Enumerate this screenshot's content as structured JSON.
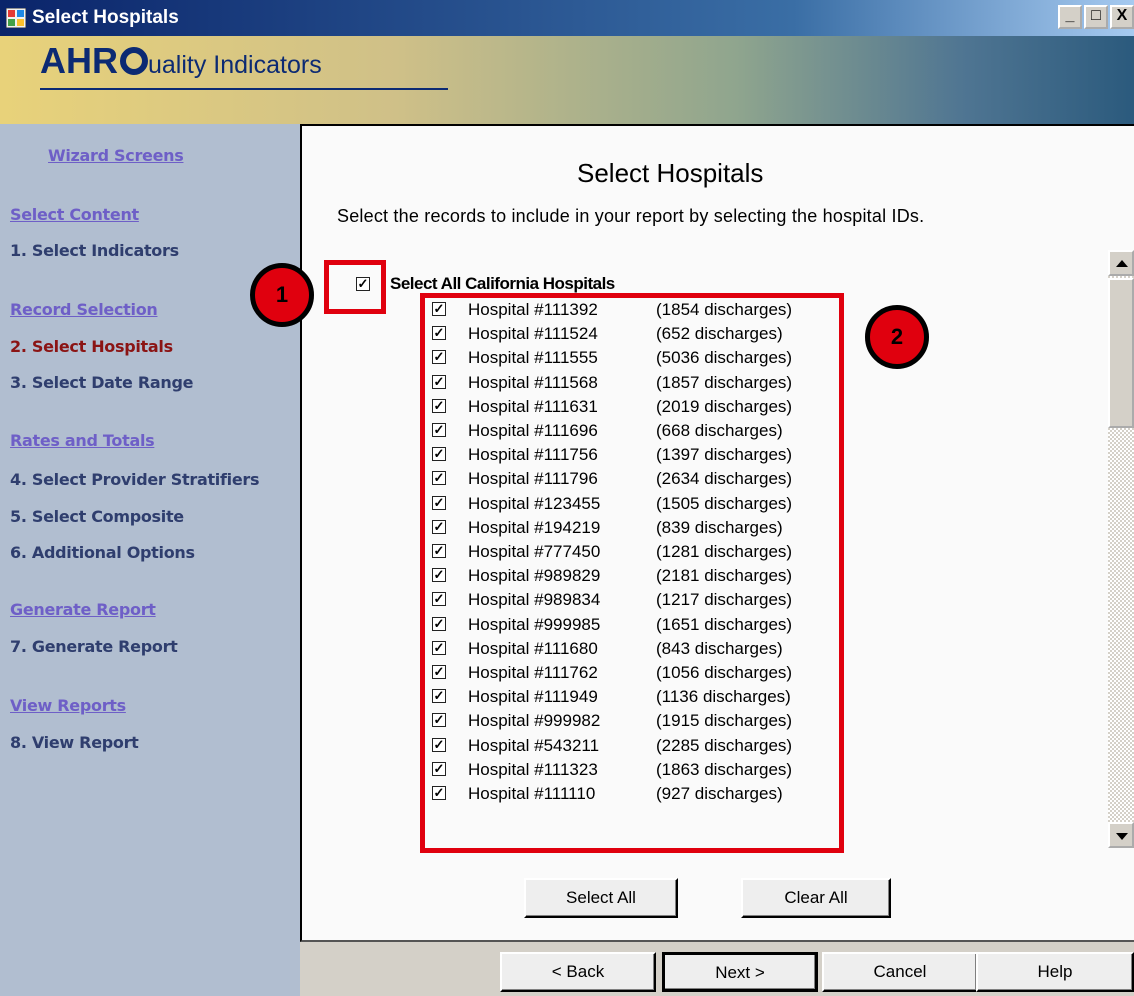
{
  "window": {
    "title": "Select Hospitals",
    "controls": [
      "_",
      "□",
      "X"
    ]
  },
  "banner": {
    "logo_bold": "AHR",
    "logo_rest": "uality Indicators"
  },
  "sidebar": {
    "header": "Wizard Screens",
    "sections": [
      {
        "heading": "Select Content",
        "steps": [
          {
            "label": "1. Select Indicators",
            "current": false
          }
        ]
      },
      {
        "heading": "Record Selection",
        "steps": [
          {
            "label": "2. Select Hospitals",
            "current": true
          },
          {
            "label": "3. Select Date Range",
            "current": false
          }
        ]
      },
      {
        "heading": "Rates and Totals",
        "steps": [
          {
            "label": "4. Select Provider Stratifiers",
            "current": false
          },
          {
            "label": "5. Select Composite",
            "current": false
          },
          {
            "label": "6. Additional Options",
            "current": false
          }
        ]
      },
      {
        "heading": "Generate Report",
        "steps": [
          {
            "label": "7. Generate Report",
            "current": false
          }
        ]
      },
      {
        "heading": "View Reports",
        "steps": [
          {
            "label": "8. View Report",
            "current": false
          }
        ]
      }
    ]
  },
  "main": {
    "title": "Select Hospitals",
    "instructions": "Select the records to include in your report by selecting the hospital IDs.",
    "select_all_checkbox": {
      "label": "Select All California Hospitals",
      "checked": true
    },
    "hospitals": [
      {
        "name": "Hospital #111392",
        "discharges": "(1854 discharges)",
        "checked": true
      },
      {
        "name": "Hospital #111524",
        "discharges": "(652 discharges)",
        "checked": true
      },
      {
        "name": "Hospital #111555",
        "discharges": "(5036 discharges)",
        "checked": true
      },
      {
        "name": "Hospital #111568",
        "discharges": "(1857 discharges)",
        "checked": true
      },
      {
        "name": "Hospital #111631",
        "discharges": "(2019 discharges)",
        "checked": true
      },
      {
        "name": "Hospital #111696",
        "discharges": "(668 discharges)",
        "checked": true
      },
      {
        "name": "Hospital #111756",
        "discharges": "(1397 discharges)",
        "checked": true
      },
      {
        "name": "Hospital #111796",
        "discharges": "(2634 discharges)",
        "checked": true
      },
      {
        "name": "Hospital #123455",
        "discharges": "(1505 discharges)",
        "checked": true
      },
      {
        "name": "Hospital #194219",
        "discharges": "(839 discharges)",
        "checked": true
      },
      {
        "name": "Hospital #777450",
        "discharges": "(1281 discharges)",
        "checked": true
      },
      {
        "name": "Hospital #989829",
        "discharges": "(2181 discharges)",
        "checked": true
      },
      {
        "name": "Hospital #989834",
        "discharges": "(1217 discharges)",
        "checked": true
      },
      {
        "name": "Hospital #999985",
        "discharges": "(1651 discharges)",
        "checked": true
      },
      {
        "name": "Hospital #111680",
        "discharges": "(843 discharges)",
        "checked": true
      },
      {
        "name": "Hospital #111762",
        "discharges": "(1056 discharges)",
        "checked": true
      },
      {
        "name": "Hospital #111949",
        "discharges": "(1136 discharges)",
        "checked": true
      },
      {
        "name": "Hospital #999982",
        "discharges": "(1915 discharges)",
        "checked": true
      },
      {
        "name": "Hospital #543211",
        "discharges": "(2285 discharges)",
        "checked": true
      },
      {
        "name": "Hospital #111323",
        "discharges": "(1863 discharges)",
        "checked": true
      },
      {
        "name": "Hospital #111110",
        "discharges": "(927 discharges)",
        "checked": true
      }
    ],
    "select_all_button": "Select All",
    "clear_all_button": "Clear All"
  },
  "annotations": {
    "callout_1": "1",
    "callout_2": "2"
  },
  "footer": {
    "back": "< Back",
    "next": "Next >",
    "cancel": "Cancel",
    "help": "Help"
  },
  "colors": {
    "callout_red": "#e0000e",
    "sidebar_bg": "#b1bed0",
    "sidebar_heading": "#6e5fc7",
    "current_step": "#8b1414"
  }
}
